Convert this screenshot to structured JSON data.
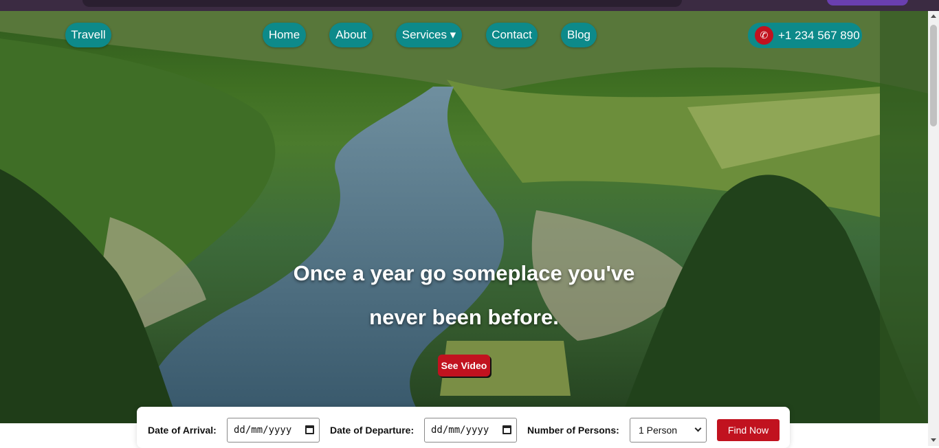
{
  "nav": {
    "brand": "Travell",
    "items": [
      {
        "label": "Home"
      },
      {
        "label": "About"
      },
      {
        "label": "Services ▾"
      },
      {
        "label": "Contact"
      },
      {
        "label": "Blog"
      }
    ],
    "phone": "+1 234 567 890"
  },
  "hero": {
    "headline_line1": "Once a year go someplace you've",
    "headline_line2": "never been before.",
    "video_button": "See Video"
  },
  "booking": {
    "arrival_label": "Date of Arrival:",
    "arrival_value": "dd/mm/yyyy",
    "departure_label": "Date of Departure:",
    "departure_value": "dd/mm/yyyy",
    "persons_label": "Number of Persons:",
    "persons_value": "1 Person",
    "find_button": "Find Now"
  },
  "colors": {
    "accent": "#0d8a8a",
    "action": "#c1121f"
  },
  "icons": [
    "phone-icon",
    "calendar-icon",
    "chevron-down-icon"
  ]
}
